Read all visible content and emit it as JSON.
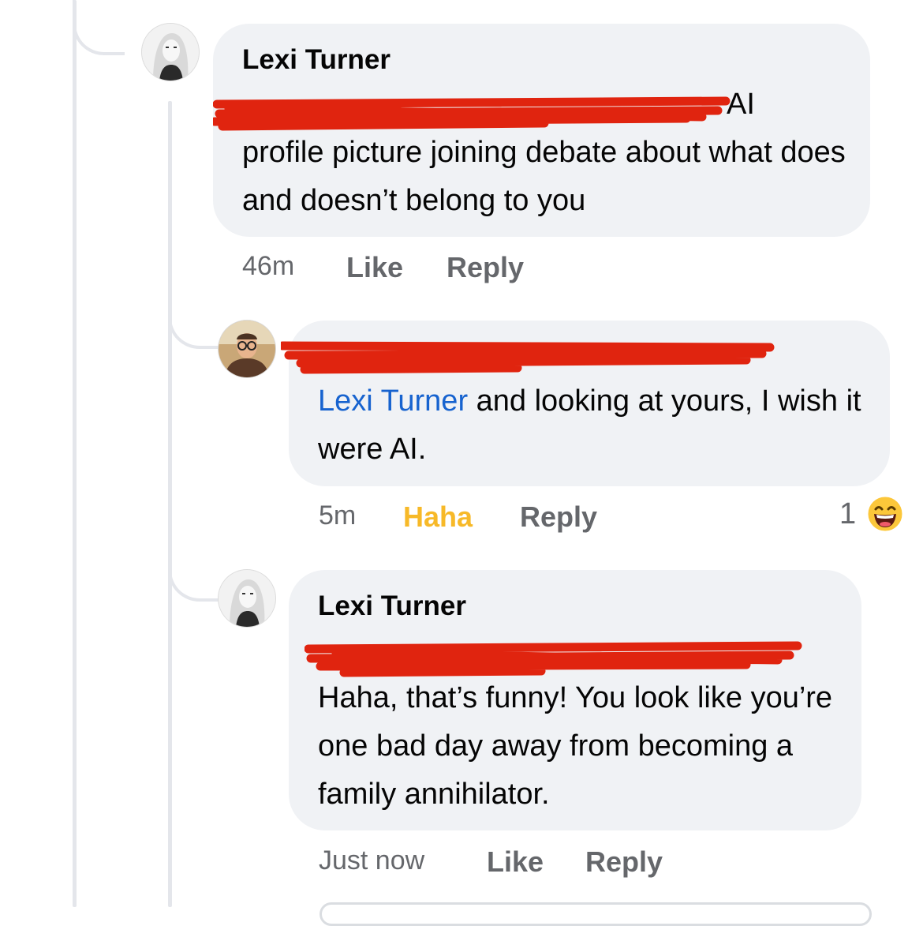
{
  "comments": [
    {
      "author": "Lexi Turner",
      "text_tail": "AI",
      "text_body": "profile picture joining debate about what does and doesn’t belong to you",
      "time": "46m",
      "like_label": "Like",
      "reply_label": "Reply"
    },
    {
      "mention": "Lexi Turner",
      "text": " and looking at yours, I wish it were AI.",
      "time": "5m",
      "reaction_label": "Haha",
      "reply_label": "Reply",
      "reaction_count": "1",
      "reaction_icon": "haha-emoji-icon"
    },
    {
      "author": "Lexi Turner",
      "text": "Haha, that’s funny! You look like you’re one bad day away from becoming a family annihilator.",
      "time": "Just now",
      "like_label": "Like",
      "reply_label": "Reply"
    }
  ],
  "colors": {
    "bubble": "#f0f2f5",
    "mention": "#1763cf",
    "meta": "#65676b",
    "haha": "#f7b928",
    "redaction": "#e0240f"
  }
}
